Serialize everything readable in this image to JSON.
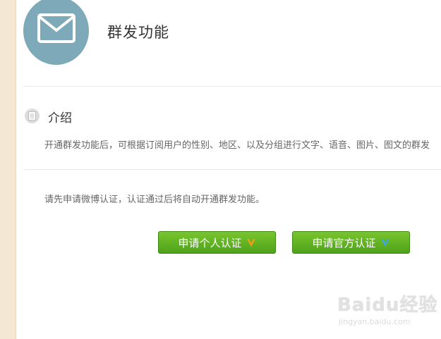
{
  "header": {
    "title": "群发功能"
  },
  "intro": {
    "title": "介绍",
    "text": "开通群发功能后，可根据订阅用户的性别、地区、以及分组进行文字、语音、图片、图文的群发"
  },
  "notice": {
    "text": "请先申请微博认证，认证通过后将自动开通群发功能。"
  },
  "buttons": {
    "personal_label": "申请个人认证",
    "official_label": "申请官方认证"
  },
  "icons": {
    "mail": "mail-icon",
    "doc": "document-icon",
    "personal_v": "orange-v-badge-icon",
    "official_v": "blue-v-badge-icon"
  },
  "colors": {
    "accent_green": "#5bb020",
    "circle": "#7ea9b8",
    "sidebar": "#f4e8d4",
    "personal_v": "#f39c12",
    "official_v": "#3aa8e0"
  },
  "watermark": {
    "logo": "Baidu经验",
    "url": "jingyan.baidu.com"
  }
}
